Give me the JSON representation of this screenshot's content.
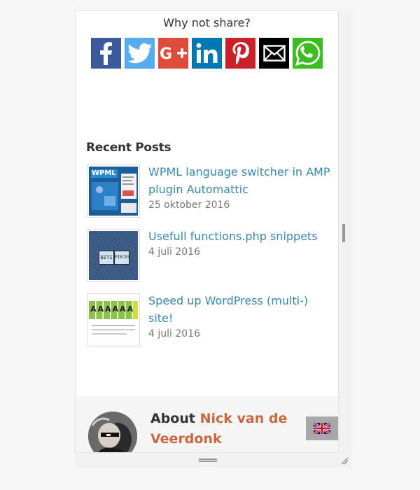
{
  "share": {
    "title": "Why not share?",
    "buttons": [
      {
        "network": "facebook",
        "icon": "facebook-icon",
        "color": "#3b5998"
      },
      {
        "network": "twitter",
        "icon": "twitter-icon",
        "color": "#55acee"
      },
      {
        "network": "google-plus",
        "icon": "google-plus-icon",
        "color": "#dd4b39"
      },
      {
        "network": "linkedin",
        "icon": "linkedin-icon",
        "color": "#0077b5"
      },
      {
        "network": "pinterest",
        "icon": "pinterest-icon",
        "color": "#cb2027"
      },
      {
        "network": "email",
        "icon": "email-icon",
        "color": "#000000"
      },
      {
        "network": "whatsapp",
        "icon": "whatsapp-icon",
        "color": "#3cbd1f"
      }
    ]
  },
  "recent_posts": {
    "title": "Recent Posts",
    "items": [
      {
        "title": "WPML language switcher in AMP plugin Automattic",
        "date": "25 oktober 2016",
        "thumb_icon": "wpml-thumbnail"
      },
      {
        "title": "Usefull functions.php snippets",
        "date": "4 juli 2016",
        "thumb_icon": "bits-and-pieces-thumbnail"
      },
      {
        "title": "Speed up WordPress (multi-) site!",
        "date": "4 juli 2016",
        "thumb_icon": "speed-chart-thumbnail"
      }
    ]
  },
  "about": {
    "prefix": "About",
    "name_line1": "Nick van de",
    "name_line2": "Veerdonk",
    "name_color": "#c8683f"
  },
  "language": {
    "icon": "uk-flag-icon"
  }
}
